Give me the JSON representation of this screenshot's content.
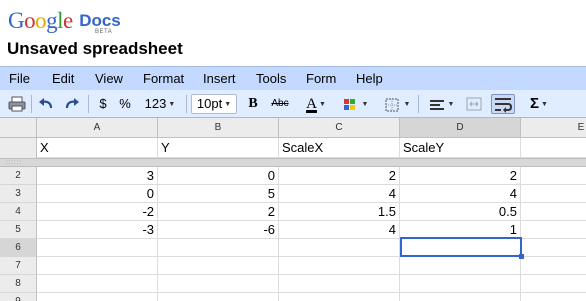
{
  "app": {
    "logo_google": "Google",
    "logo_docs": "Docs",
    "beta": "BETA",
    "doc_title": "Unsaved spreadsheet",
    "brand_blue": "#3366cc"
  },
  "menu": [
    {
      "label": "File"
    },
    {
      "label": "Edit"
    },
    {
      "label": "View"
    },
    {
      "label": "Format"
    },
    {
      "label": "Insert"
    },
    {
      "label": "Tools"
    },
    {
      "label": "Form"
    },
    {
      "label": "Help"
    }
  ],
  "toolbar": {
    "print_icon": "print-icon",
    "undo_icon": "undo-icon",
    "redo_icon": "redo-icon",
    "currency_label": "$",
    "percent_label": "%",
    "number_format_label": "123",
    "font_size_label": "10pt",
    "bold_label": "B",
    "strike_label": "Abc",
    "text_color_label": "A",
    "text_color": "#000000",
    "background_color_icon": "background-color-icon",
    "borders_icon": "borders-icon",
    "align_icon": "align-left-icon",
    "merge_icon": "merge-cells-icon",
    "wrap_icon": "wrap-text-icon",
    "sum_label": "Σ"
  },
  "grid": {
    "columns": [
      "A",
      "B",
      "C",
      "D",
      "E"
    ],
    "header_row": [
      "X",
      "Y",
      "ScaleX",
      "ScaleY"
    ],
    "row_numbers": [
      "2",
      "3",
      "4",
      "5",
      "6",
      "7",
      "8",
      "9"
    ],
    "rows": [
      [
        "3",
        "0",
        "2",
        "2"
      ],
      [
        "0",
        "5",
        "4",
        "4"
      ],
      [
        "-2",
        "2",
        "1.5",
        "0.5"
      ],
      [
        "-3",
        "-6",
        "4",
        "1"
      ],
      [
        "",
        "",
        "",
        ""
      ],
      [
        "",
        "",
        "",
        ""
      ],
      [
        "",
        "",
        "",
        ""
      ],
      [
        "",
        "",
        "",
        ""
      ]
    ],
    "selected_cell": "D6"
  }
}
